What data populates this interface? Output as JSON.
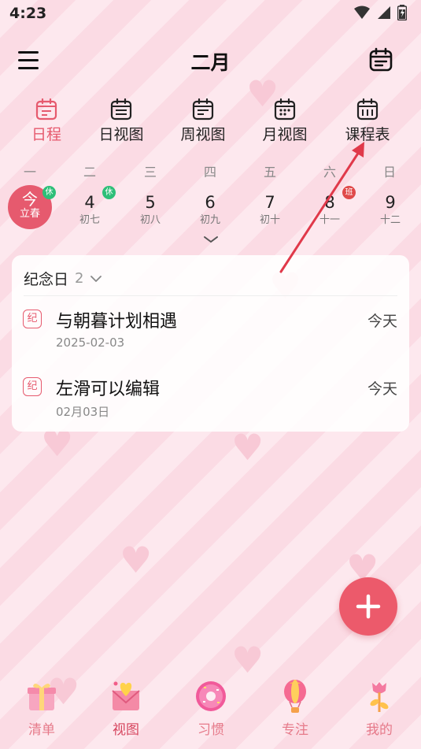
{
  "status": {
    "time": "4:23"
  },
  "header": {
    "title": "二月"
  },
  "tabs": [
    {
      "label": "日程",
      "active": true
    },
    {
      "label": "日视图",
      "active": false
    },
    {
      "label": "周视图",
      "active": false
    },
    {
      "label": "月视图",
      "active": false
    },
    {
      "label": "课程表",
      "active": false
    }
  ],
  "week": {
    "weekdays": [
      "一",
      "二",
      "三",
      "四",
      "五",
      "六",
      "日"
    ],
    "today": {
      "label": "今",
      "lunar": "立春",
      "badge": "休"
    },
    "days": [
      {
        "num": "4",
        "lunar": "初七",
        "badge": "休"
      },
      {
        "num": "5",
        "lunar": "初八"
      },
      {
        "num": "6",
        "lunar": "初九"
      },
      {
        "num": "7",
        "lunar": "初十"
      },
      {
        "num": "8",
        "lunar": "十一",
        "badge": "班"
      },
      {
        "num": "9",
        "lunar": "十二"
      }
    ]
  },
  "anniversary": {
    "title": "纪念日",
    "count": "2",
    "items": [
      {
        "icon": "纪",
        "title": "与朝暮计划相遇",
        "date": "2025-02-03",
        "when": "今天"
      },
      {
        "icon": "纪",
        "title": "左滑可以编辑",
        "date": "02月03日",
        "when": "今天"
      }
    ]
  },
  "bottom_nav": [
    {
      "label": "清单",
      "icon": "gift-icon"
    },
    {
      "label": "视图",
      "icon": "envelope-heart-icon",
      "active": true
    },
    {
      "label": "习惯",
      "icon": "donut-icon"
    },
    {
      "label": "专注",
      "icon": "balloon-icon"
    },
    {
      "label": "我的",
      "icon": "flower-icon"
    }
  ],
  "colors": {
    "accent": "#e65a6e",
    "fab": "#ec5a6b",
    "rest_badge": "#2dbf78",
    "work_badge": "#e04a4a",
    "arrow": "#e0394a"
  }
}
